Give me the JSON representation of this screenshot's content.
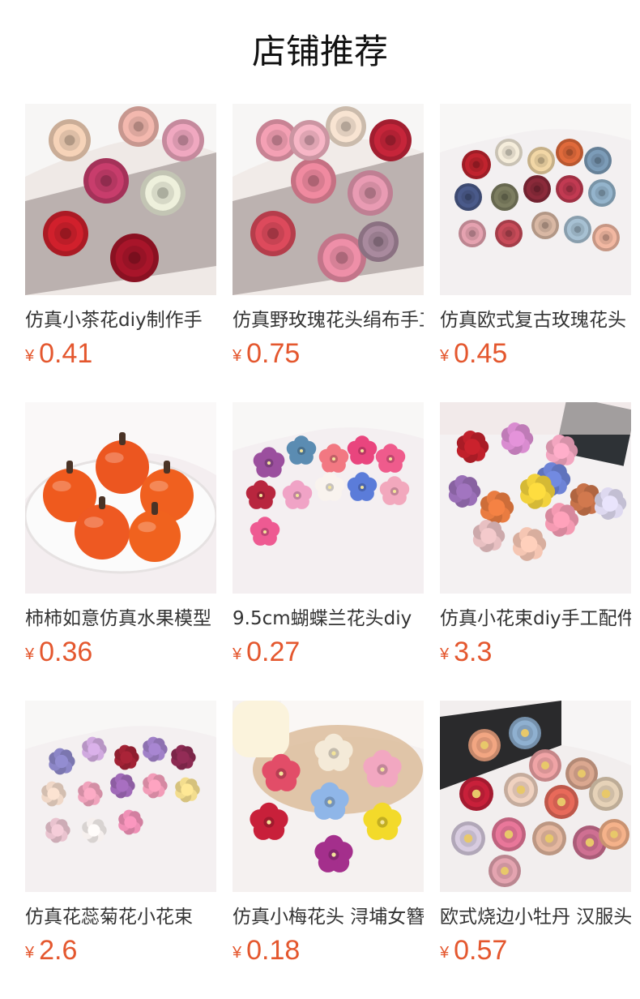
{
  "header": {
    "title": "店铺推荐"
  },
  "currency": "¥",
  "products": [
    {
      "name": "仿真小茶花diy制作手",
      "price": "0.41",
      "scene": "board",
      "bg": "#efe9e6",
      "flowers": [
        {
          "c": "#f6d3b8",
          "k": "rose"
        },
        {
          "c": "#f3b8ae",
          "k": "rose"
        },
        {
          "c": "#f0a8c0",
          "k": "rose"
        },
        {
          "c": "#c83d6c",
          "k": "rose"
        },
        {
          "c": "#eef0dc",
          "k": "rose"
        },
        {
          "c": "#d1202c",
          "k": "rose"
        },
        {
          "c": "#a8152a",
          "k": "rose"
        }
      ]
    },
    {
      "name": "仿真野玫瑰花头绢布手工",
      "price": "0.75",
      "scene": "board",
      "bg": "#f1ebe8",
      "flowers": [
        {
          "c": "#f4a0b4",
          "k": "rose"
        },
        {
          "c": "#f8e4d2",
          "k": "rose"
        },
        {
          "c": "#c6253a",
          "k": "rose"
        },
        {
          "c": "#f08aa0",
          "k": "rose"
        },
        {
          "c": "#e99bb3",
          "k": "rose"
        },
        {
          "c": "#dd4a5c",
          "k": "rose"
        },
        {
          "c": "#ee8fa8",
          "k": "rose"
        },
        {
          "c": "#f7b6c6",
          "k": "rose"
        },
        {
          "c": "#a98a9e",
          "k": "rose"
        }
      ]
    },
    {
      "name": "仿真欧式复古玫瑰花头",
      "price": "0.45",
      "scene": "scatter",
      "bg": "#f3f0f1",
      "flowers": [
        {
          "c": "#c0232e",
          "k": "rose"
        },
        {
          "c": "#f5eddb",
          "k": "rose"
        },
        {
          "c": "#f2d7a6",
          "k": "rose"
        },
        {
          "c": "#e06a3b",
          "k": "rose"
        },
        {
          "c": "#7c9cb8",
          "k": "rose"
        },
        {
          "c": "#4a5a8a",
          "k": "rose"
        },
        {
          "c": "#7c7d60",
          "k": "rose"
        },
        {
          "c": "#8b2a3a",
          "k": "rose"
        },
        {
          "c": "#c23a52",
          "k": "rose"
        },
        {
          "c": "#94b4cc",
          "k": "rose"
        },
        {
          "c": "#e5a2b0",
          "k": "rose"
        },
        {
          "c": "#c84b59",
          "k": "rose"
        },
        {
          "c": "#d9b8a4",
          "k": "rose"
        },
        {
          "c": "#a7c1d3",
          "k": "rose"
        },
        {
          "c": "#f2b8a2",
          "k": "rose"
        }
      ]
    },
    {
      "name": "柿柿如意仿真水果模型",
      "price": "0.36",
      "scene": "plate",
      "bg": "#f4eef0",
      "flowers": [
        {
          "c": "#ef5a1e",
          "k": "fruit"
        },
        {
          "c": "#ec5620",
          "k": "fruit"
        },
        {
          "c": "#f0601f",
          "k": "fruit"
        },
        {
          "c": "#ee5922",
          "k": "fruit"
        },
        {
          "c": "#f0621e",
          "k": "fruit"
        }
      ]
    },
    {
      "name": "9.5cm蝴蝶兰花头diy",
      "price": "0.27",
      "scene": "scatter",
      "bg": "#f4eff1",
      "flowers": [
        {
          "c": "#9b4f9e",
          "k": "orchid"
        },
        {
          "c": "#5b8cb2",
          "k": "orchid"
        },
        {
          "c": "#f27882",
          "k": "orchid"
        },
        {
          "c": "#e9457e",
          "k": "orchid"
        },
        {
          "c": "#ef5b8c",
          "k": "orchid"
        },
        {
          "c": "#b8263e",
          "k": "orchid"
        },
        {
          "c": "#f0a3c6",
          "k": "orchid"
        },
        {
          "c": "#f9f3ee",
          "k": "orchid"
        },
        {
          "c": "#5b7cd9",
          "k": "orchid"
        },
        {
          "c": "#f2a8bd",
          "k": "orchid"
        },
        {
          "c": "#ee5a92",
          "k": "orchid"
        }
      ]
    },
    {
      "name": "仿真小花束diy手工配件",
      "price": "3.3",
      "scene": "books",
      "bg": "#f4f1f2",
      "flowers": [
        {
          "c": "#c0202b",
          "k": "bunch"
        },
        {
          "c": "#d98cd0",
          "k": "bunch"
        },
        {
          "c": "#f3a6c0",
          "k": "bunch"
        },
        {
          "c": "#6d83d6",
          "k": "bunch"
        },
        {
          "c": "#9a6fb7",
          "k": "bunch"
        },
        {
          "c": "#f2d23c",
          "k": "bunch"
        },
        {
          "c": "#e97c41",
          "k": "bunch"
        },
        {
          "c": "#c8734a",
          "k": "bunch"
        },
        {
          "c": "#f49ab2",
          "k": "bunch"
        },
        {
          "c": "#ded9f0",
          "k": "bunch"
        },
        {
          "c": "#e8c0c2",
          "k": "bunch"
        },
        {
          "c": "#f5c6b3",
          "k": "bunch"
        }
      ]
    },
    {
      "name": "仿真花蕊菊花小花束",
      "price": "2.6",
      "scene": "scatter",
      "bg": "#f4f0f1",
      "flowers": [
        {
          "c": "#8c86c7",
          "k": "bunch"
        },
        {
          "c": "#d0a9df",
          "k": "bunch"
        },
        {
          "c": "#a22235",
          "k": "bunch"
        },
        {
          "c": "#a080c8",
          "k": "bunch"
        },
        {
          "c": "#8c2a52",
          "k": "bunch"
        },
        {
          "c": "#f0d8c8",
          "k": "bunch"
        },
        {
          "c": "#f0a3bc",
          "k": "bunch"
        },
        {
          "c": "#a06ab8",
          "k": "bunch"
        },
        {
          "c": "#f29cb8",
          "k": "bunch"
        },
        {
          "c": "#f3dd8e",
          "k": "bunch"
        },
        {
          "c": "#e9c3cf",
          "k": "bunch"
        },
        {
          "c": "#f6f0ee",
          "k": "bunch"
        },
        {
          "c": "#ef90b6",
          "k": "bunch"
        }
      ]
    },
    {
      "name": "仿真小梅花头 浔埔女簪",
      "price": "0.18",
      "scene": "basket",
      "bg": "#f5f1f0",
      "flowers": [
        {
          "c": "#f4ead8",
          "k": "plum"
        },
        {
          "c": "#e24d68",
          "k": "plum"
        },
        {
          "c": "#f2a7c1",
          "k": "plum"
        },
        {
          "c": "#c8203a",
          "k": "plum"
        },
        {
          "c": "#8fb6e8",
          "k": "plum"
        },
        {
          "c": "#f3da2a",
          "k": "plum"
        },
        {
          "c": "#a42f8c",
          "k": "plum"
        }
      ]
    },
    {
      "name": "欧式烧边小牡丹 汉服头饰",
      "price": "0.57",
      "scene": "blackbox",
      "bg": "#f2eeee",
      "flowers": [
        {
          "c": "#f2a682",
          "k": "peony"
        },
        {
          "c": "#8fb0d0",
          "k": "peony"
        },
        {
          "c": "#f0a4a6",
          "k": "peony"
        },
        {
          "c": "#dba890",
          "k": "peony"
        },
        {
          "c": "#c8203a",
          "k": "peony"
        },
        {
          "c": "#f0d2c0",
          "k": "peony"
        },
        {
          "c": "#e86a5a",
          "k": "peony"
        },
        {
          "c": "#e6d2b8",
          "k": "peony"
        },
        {
          "c": "#d8cce0",
          "k": "peony"
        },
        {
          "c": "#e9779a",
          "k": "peony"
        },
        {
          "c": "#e5b8a0",
          "k": "peony"
        },
        {
          "c": "#cf7092",
          "k": "peony"
        },
        {
          "c": "#f5b28a",
          "k": "peony"
        },
        {
          "c": "#e4a4b0",
          "k": "peony"
        }
      ]
    }
  ]
}
